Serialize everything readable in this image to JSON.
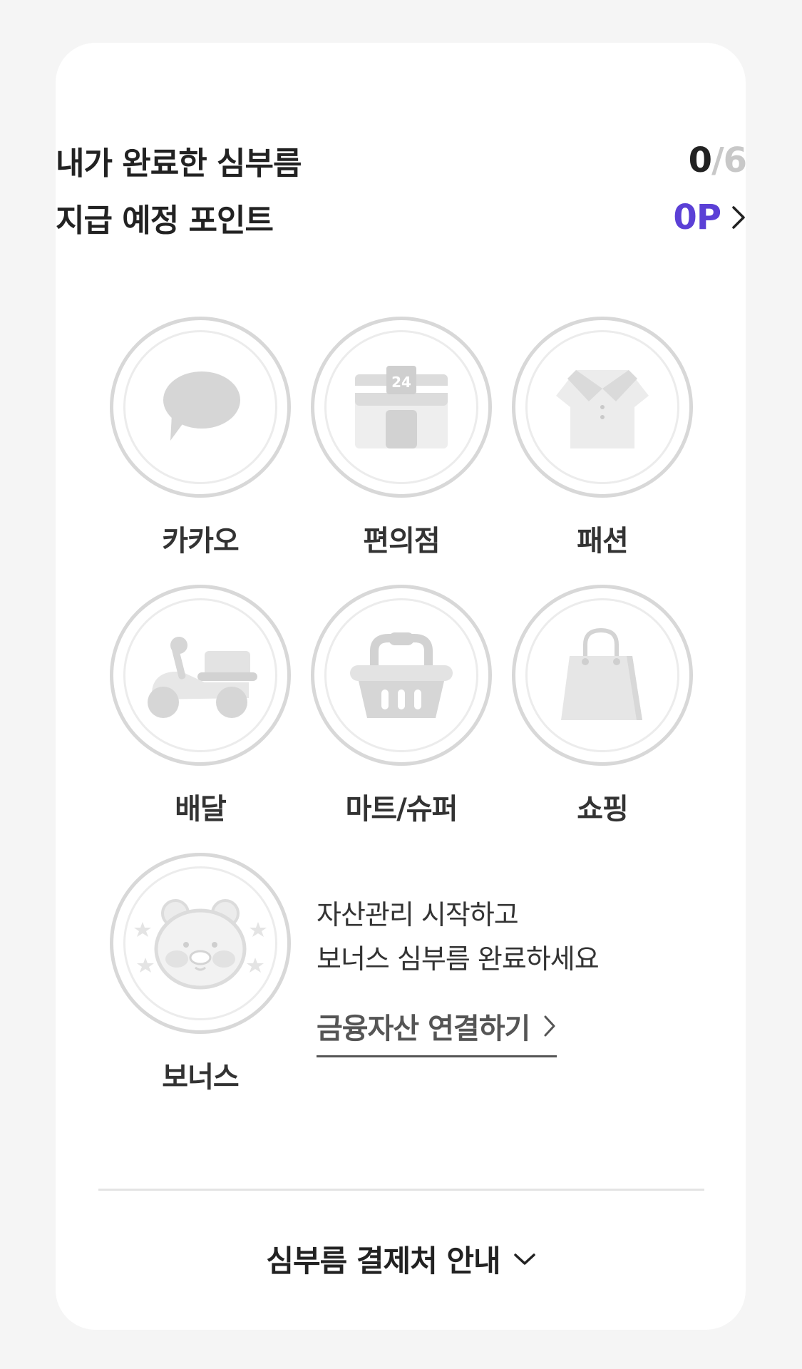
{
  "summary": {
    "completed_label": "내가 완료한 심부름",
    "completed_count": "0",
    "separator": "/",
    "total_count": "6",
    "points_label": "지급 예정 포인트",
    "points_value": "0P"
  },
  "categories": [
    {
      "label": "카카오",
      "icon": "speech-bubble-icon"
    },
    {
      "label": "편의점",
      "icon": "convenience-store-icon",
      "store_badge": "24"
    },
    {
      "label": "패션",
      "icon": "shirt-icon"
    },
    {
      "label": "배달",
      "icon": "scooter-icon"
    },
    {
      "label": "마트/슈퍼",
      "icon": "basket-icon"
    },
    {
      "label": "쇼핑",
      "icon": "shopping-bag-icon"
    }
  ],
  "bonus": {
    "label": "보너스",
    "icon": "character-face-icon",
    "line1": "자산관리 시작하고",
    "line2": "보너스 심부름 완료하세요",
    "link_label": "금융자산 연결하기"
  },
  "footer": {
    "toggle_label": "심부름 결제처 안내"
  },
  "colors": {
    "accent": "#5b40d6",
    "icon_gray": "#d6d6d6",
    "background": "#f5f5f5"
  }
}
